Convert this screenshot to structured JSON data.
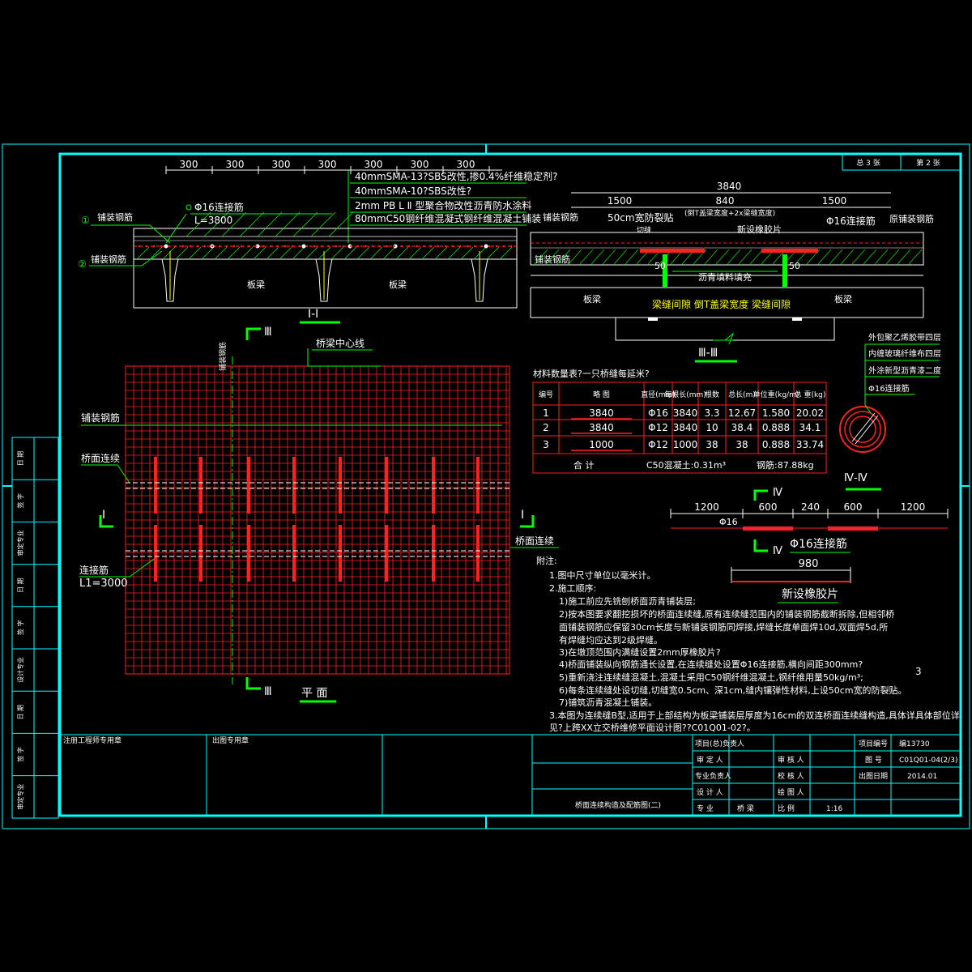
{
  "sheet": {
    "total_label": "总 3 张",
    "sheet_label": "第 2 张",
    "scale_note": "3"
  },
  "top_dims": [
    "300",
    "300",
    "300",
    "300",
    "300",
    "300",
    "300"
  ],
  "layers": [
    "40mmSMA-13?SBS改性,掺0.4%纤维稳定剂?",
    "40mmSMA-10?SBS改性?",
    "2mm PB L Ⅱ 型聚合物改性沥青防水涂料",
    "80mmC50钢纤维混凝式钢纤维混凝土铺装"
  ],
  "section1": {
    "rebar1": "铺装钢筋",
    "rebar2": "铺装钢筋",
    "conn_bar": "Φ16连接筋",
    "conn_len": "L=3800",
    "slab_left": "板梁",
    "slab_right": "板梁",
    "marker1": "①",
    "marker2": "②",
    "title": "I-I"
  },
  "section3": {
    "total": "3840",
    "left": "1500",
    "mid": "840",
    "right": "1500",
    "mid_note": "(倒T盖梁宽度+2x梁缝宽度)",
    "waterproof": "50cm宽防裂贴",
    "cut_seam": "切缝",
    "rubber": "新设橡胶片",
    "conn_bar": "Φ16连接筋",
    "orig_rebar": "原铺装钢筋",
    "rebar": "铺装钢筋",
    "dim50a": "50",
    "dim50b": "50",
    "fill": "沥青填料填充",
    "slab_left": "板梁",
    "slab_right": "板梁",
    "gap_note": "梁缝间隙 倒T盖梁宽度 梁缝间隙",
    "title": "Ⅲ-Ⅲ"
  },
  "plan": {
    "marker3": "Ⅲ",
    "centerline": "桥梁中心线",
    "rebar_label": "铺装钢筋",
    "rebar_label_v": "铺装钢筋",
    "continuity1": "桥面连续",
    "continuity2": "桥面连续",
    "conn_label": "连接筋",
    "conn_len": "L1=3000",
    "marker1_left": "I",
    "marker1_right": "I",
    "marker3_bottom": "Ⅲ",
    "title": "平 面"
  },
  "table": {
    "caption": "材料数量表?一只桥缝每延米?",
    "headers": [
      "编号",
      "略 图",
      "直径(mm)",
      "每根长(mm)",
      "根数",
      "总长(m)",
      "单位重(kg/m)",
      "总 重(kg)"
    ],
    "rows": [
      [
        "1",
        "3840",
        "Φ16",
        "3840",
        "3.3",
        "12.67",
        "1.580",
        "20.02"
      ],
      [
        "2",
        "3840",
        "Φ12",
        "3840",
        "10",
        "38.4",
        "0.888",
        "34.1"
      ],
      [
        "3",
        "1000",
        "Φ12",
        "1000",
        "38",
        "38",
        "0.888",
        "33.74"
      ]
    ],
    "total_label": "合 计",
    "concrete": "C50混凝土:0.31m³",
    "steel": "钢筋:87.88kg"
  },
  "section4": {
    "layers": [
      "外包聚乙烯胶带四层",
      "内缠玻璃纤维布四层",
      "外涂新型沥青漆二度",
      "Φ16连接筋"
    ],
    "title": "Ⅳ-Ⅳ"
  },
  "bar_detail": {
    "dims": [
      "1200",
      "600",
      "240",
      "600",
      "1200"
    ],
    "bar": "Φ16",
    "label": "Φ16连接筋",
    "marker": "Ⅳ"
  },
  "rubber_detail": {
    "dim": "980",
    "label": "新设橡胶片"
  },
  "notes": [
    "附注:",
    "1.图中尺寸单位以毫米计。",
    "2.施工顺序:",
    "1)施工前应先铣刨桥面沥青铺装层;",
    "2)按本图要求翻挖损坏的桥面连续缝,原有连续缝范围内的铺装钢筋截断拆除,但相邻桥",
    "面铺装钢筋应保留30cm长度与新铺装钢筋同焊接,焊缝长度单面焊10d,双面焊5d,所",
    "有焊缝均应达到2级焊缝。",
    "3)在墩顶范围内满缝设置2mm厚橡胶片?",
    "4)桥面铺装纵向钢筋通长设置,在连续缝处设置Φ16连接筋,横向间距300mm?",
    "5)重新浇注连续缝混凝土,混凝土采用C50钢纤维混凝土,钢纤维用量50kg/m³;",
    "6)每条连续缝处设切缝,切缝宽0.5cm、深1cm,缝内镶弹性材料,上设50cm宽的防裂贴。",
    "7)铺筑沥青混凝土铺装。",
    "3.本图为连续缝B型,适用于上部结构为板梁铺装层厚度为16cm的双连桥面连续缝构造,具体详具体部位详",
    "见?上跨XX立交桥维修平面设计图??C01Q01-02?。"
  ],
  "titleblock": {
    "seal1": "注册工程师专用章",
    "seal2": "出图专用章",
    "drawing_title": "桥面连续构造及配筋图(二)",
    "r1": [
      "项目(总)负责人",
      "",
      "项目编号",
      "编13730"
    ],
    "r2": [
      "审 定 人",
      "审 核 人",
      "图 号",
      "C01Q01-04(2/3)"
    ],
    "r3": [
      "专业负责人",
      "校 核 人",
      "出图日期",
      "2014.01"
    ],
    "r4": [
      "设 计 人",
      "绘 图 人"
    ],
    "r5": [
      "专 业",
      "桥 梁",
      "比 例",
      "1:16"
    ]
  },
  "side_strip": [
    "日 期",
    "签 字",
    "审定专业",
    "日 期",
    "签 字",
    "设计专业",
    "日 期",
    "签 字",
    "审定专业"
  ]
}
